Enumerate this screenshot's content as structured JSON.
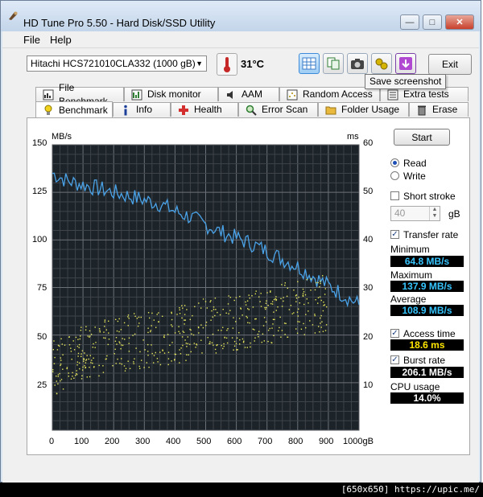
{
  "window": {
    "title": "HD Tune Pro 5.50 - Hard Disk/SSD Utility"
  },
  "menu": {
    "file": "File",
    "help": "Help"
  },
  "toolbar": {
    "drive": "Hitachi HCS721010CLA332 (1000 gB)",
    "temperature": "31°C",
    "exit_label": "Exit",
    "tooltip": "Save screenshot"
  },
  "tabs": {
    "row1": [
      "File Benchmark",
      "Disk monitor",
      "AAM",
      "Random Access",
      "Extra tests"
    ],
    "row2": [
      "Benchmark",
      "Info",
      "Health",
      "Error Scan",
      "Folder Usage",
      "Erase"
    ]
  },
  "controls": {
    "start": "Start",
    "read": "Read",
    "write": "Write",
    "short_stroke": "Short stroke",
    "stroke_value": "40",
    "stroke_unit": "gB",
    "transfer_rate": "Transfer rate",
    "minimum_label": "Minimum",
    "minimum_value": "64.8 MB/s",
    "maximum_label": "Maximum",
    "maximum_value": "137.9 MB/s",
    "average_label": "Average",
    "average_value": "108.9 MB/s",
    "access_time_label": "Access time",
    "access_time_value": "18.6 ms",
    "burst_rate_label": "Burst rate",
    "burst_rate_value": "206.1 MB/s",
    "cpu_label": "CPU usage",
    "cpu_value": "14.0%"
  },
  "colors": {
    "line": "#4aa3e8",
    "dots": "#e8e85a",
    "value_cyan": "#36c5ff",
    "value_yellow": "#ffe600",
    "value_white": "#ffffff"
  },
  "chart_data": {
    "type": "line",
    "left_unit": "MB/s",
    "right_unit": "ms",
    "x_ticks": [
      "0",
      "100",
      "200",
      "300",
      "400",
      "500",
      "600",
      "700",
      "800",
      "900",
      "1000gB"
    ],
    "y_left_ticks": [
      "150",
      "125",
      "100",
      "75",
      "50",
      "25"
    ],
    "y_right_ticks": [
      "60",
      "50",
      "40",
      "30",
      "20",
      "10"
    ],
    "xlim": [
      0,
      1000
    ],
    "ylim_left": [
      0,
      150
    ],
    "ylim_right": [
      0,
      60
    ],
    "grid": true,
    "series": [
      {
        "x": [
          0,
          50,
          100,
          150,
          200,
          250,
          300,
          350,
          400,
          450,
          500,
          550,
          600,
          650,
          700,
          750,
          800,
          850,
          900,
          950,
          1000
        ],
        "values": [
          135,
          131,
          129,
          127,
          125,
          123,
          121,
          119,
          115,
          112,
          108,
          104,
          101,
          98,
          94,
          90,
          86,
          81,
          76,
          71,
          66
        ]
      },
      {
        "x": [
          0,
          100,
          200,
          300,
          400,
          500,
          600,
          700,
          800,
          900
        ],
        "values": [
          13,
          17,
          18,
          19,
          20,
          22,
          23,
          24,
          26,
          27
        ]
      }
    ]
  }
}
